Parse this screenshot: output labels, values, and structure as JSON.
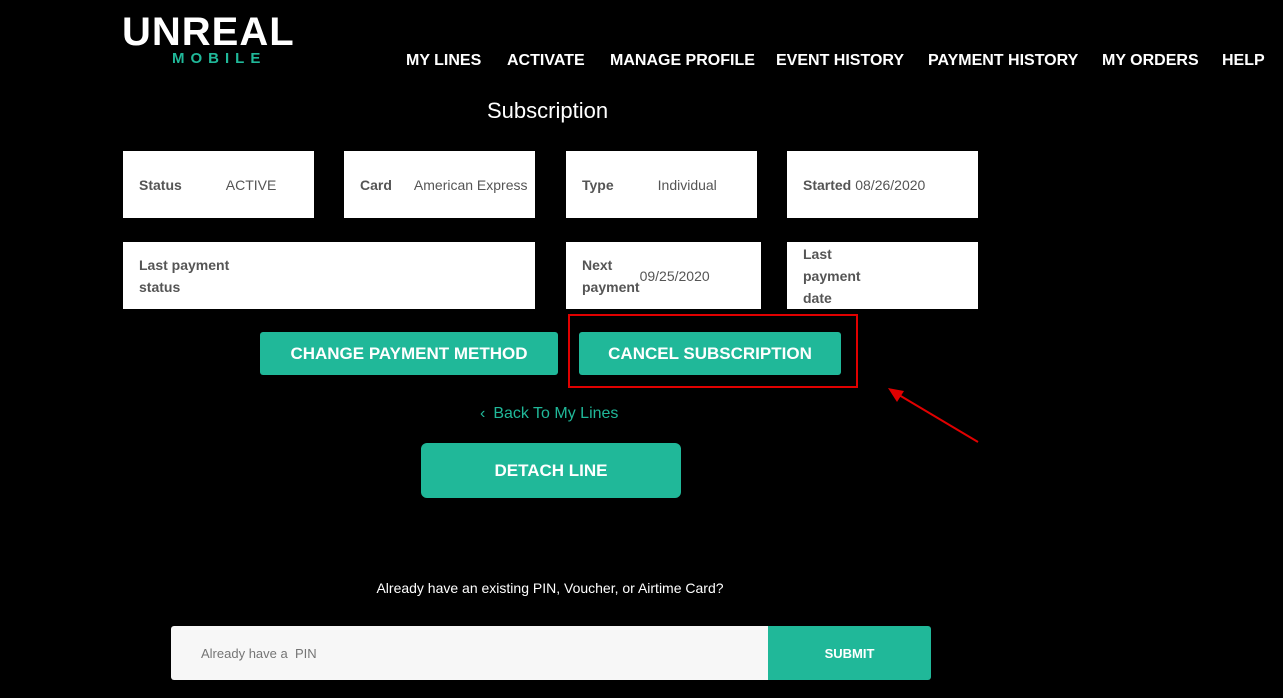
{
  "logo": {
    "line1": "UNREAL",
    "line2": "MOBILE"
  },
  "nav": [
    "MY LINES",
    "ACTIVATE",
    "MANAGE PROFILE",
    "EVENT HISTORY",
    "PAYMENT HISTORY",
    "MY ORDERS",
    "HELP"
  ],
  "title": "Subscription",
  "fields": {
    "status": {
      "label": "Status",
      "value": "ACTIVE"
    },
    "card": {
      "label": "Card",
      "value": "American Express"
    },
    "type": {
      "label": "Type",
      "value": "Individual"
    },
    "started": {
      "label": "Started",
      "value": "08/26/2020"
    },
    "last_status": {
      "label1": "Last payment",
      "label2": "status",
      "value": ""
    },
    "next": {
      "label1": "Next",
      "label2": "payment",
      "value": "09/25/2020"
    },
    "last_date": {
      "label1": "Last",
      "label2": "payment",
      "label3": "date"
    }
  },
  "buttons": {
    "change": "CHANGE PAYMENT METHOD",
    "cancel": "CANCEL SUBSCRIPTION",
    "back": "Back To My Lines",
    "detach": "DETACH LINE",
    "submit": "SUBMIT"
  },
  "pin": {
    "prompt": "Already have an existing PIN, Voucher, or Airtime Card?",
    "placeholder": "Already have a  PIN"
  },
  "colors": {
    "accent": "#20b899",
    "highlight": "#e00000"
  }
}
